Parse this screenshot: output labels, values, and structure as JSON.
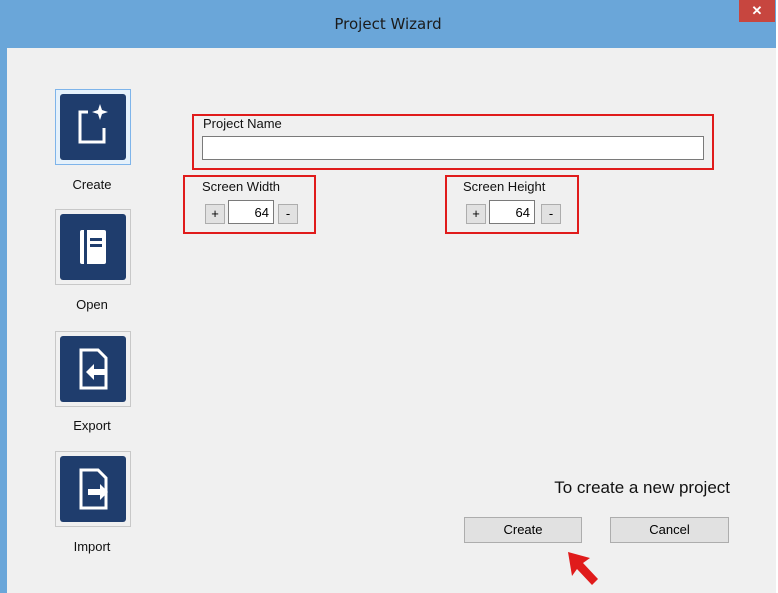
{
  "window": {
    "title": "Project Wizard",
    "close_glyph": "✕"
  },
  "sidebar": {
    "items": [
      {
        "label": "Create",
        "icon": "new-project-icon",
        "selected": true
      },
      {
        "label": "Open",
        "icon": "open-book-icon",
        "selected": false
      },
      {
        "label": "Export",
        "icon": "export-document-icon",
        "selected": false
      },
      {
        "label": "Import",
        "icon": "import-document-icon",
        "selected": false
      }
    ]
  },
  "form": {
    "project_name": {
      "label": "Project Name",
      "value": "",
      "placeholder": ""
    },
    "screen_width": {
      "label": "Screen Width",
      "value": "64",
      "plus": "+",
      "minus": "-"
    },
    "screen_height": {
      "label": "Screen Height",
      "value": "64",
      "plus": "+",
      "minus": "-"
    }
  },
  "footer": {
    "hint": "To create a new project",
    "create_label": "Create",
    "cancel_label": "Cancel"
  },
  "colors": {
    "titlebar": "#6aa6d9",
    "close_button": "#c7463f",
    "icon_tile": "#1f3d6d",
    "highlight": "#e01b1b"
  }
}
